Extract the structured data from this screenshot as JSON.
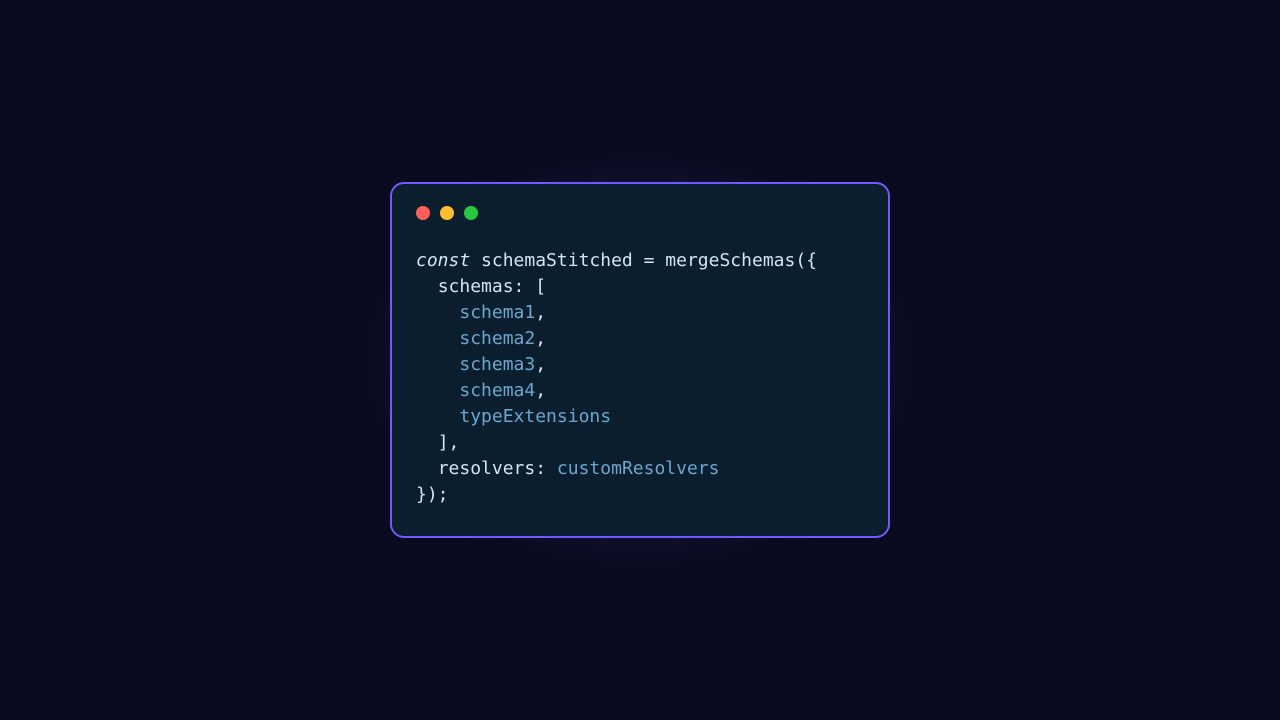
{
  "code": {
    "keyword_const": "const",
    "varname": "schemaStitched",
    "op_eq": "=",
    "fn_name": "mergeSchemas",
    "paren_open": "({",
    "prop_schemas": "schemas",
    "colon": ":",
    "bracket_open": "[",
    "item1": "schema1",
    "item2": "schema2",
    "item3": "schema3",
    "item4": "schema4",
    "item5": "typeExtensions",
    "comma": ",",
    "bracket_close": "]",
    "prop_resolvers": "resolvers",
    "val_resolvers": "customResolvers",
    "paren_close": "});"
  },
  "window_buttons": {
    "close": "close",
    "minimize": "minimize",
    "maximize": "maximize"
  }
}
